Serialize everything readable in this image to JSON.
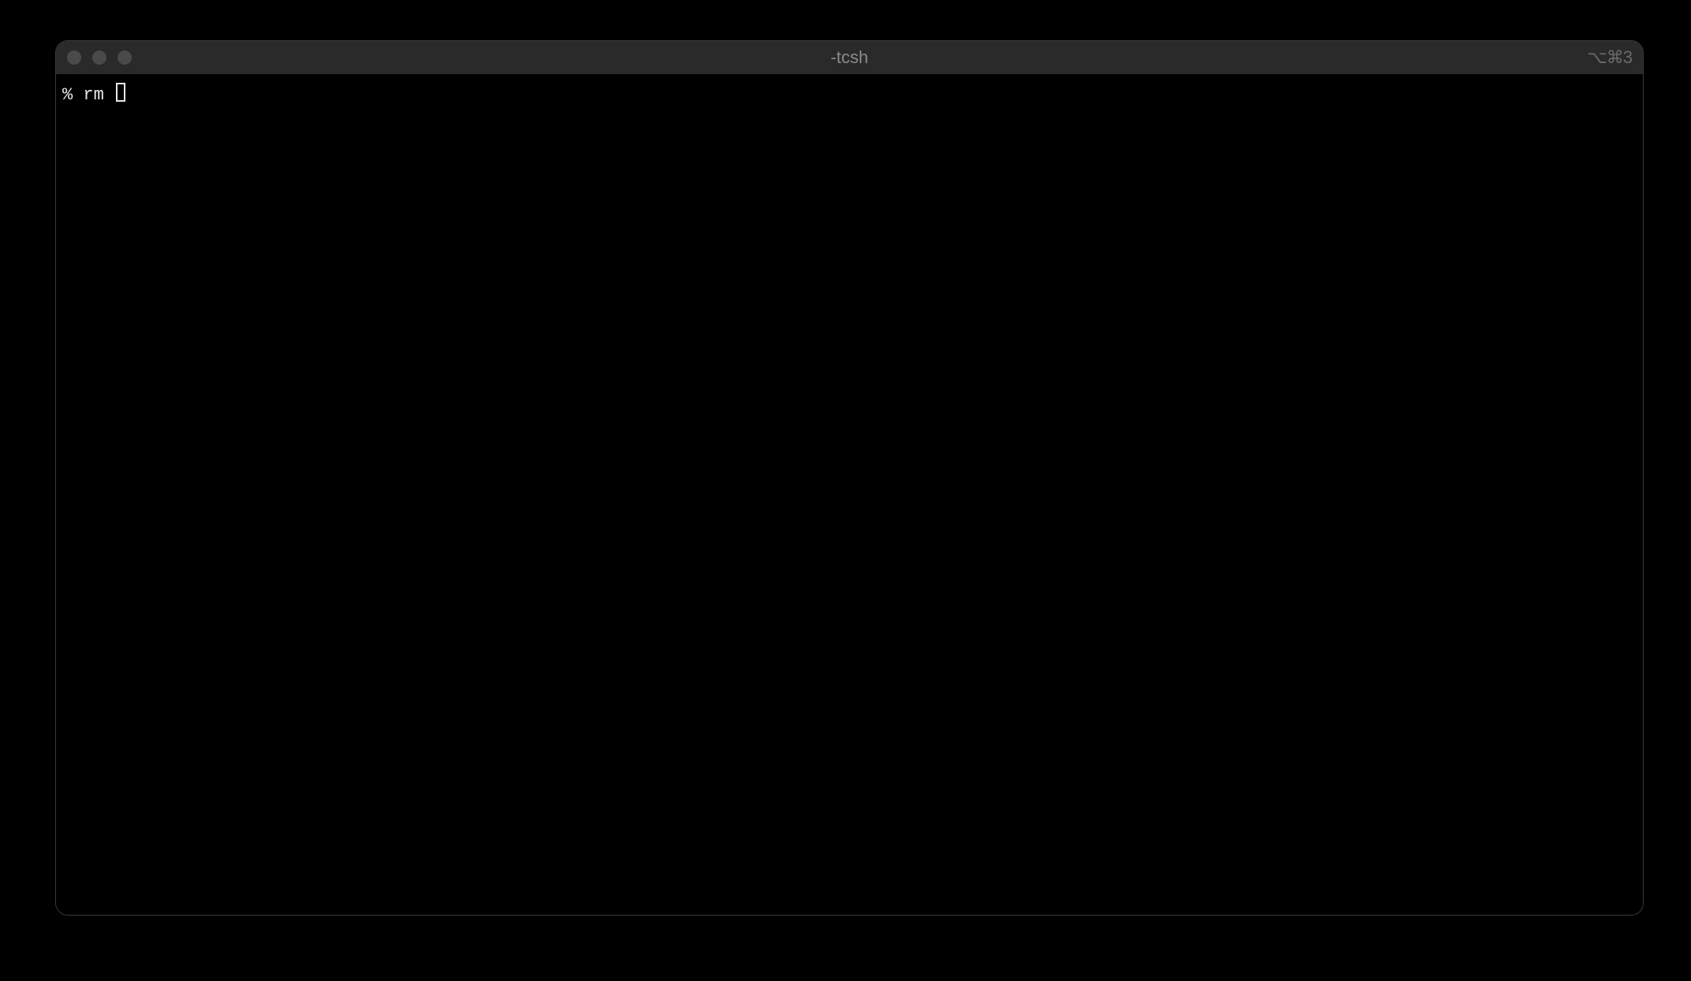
{
  "window": {
    "title": "-tcsh",
    "shortcut": "⌥⌘3"
  },
  "terminal": {
    "prompt": "% ",
    "command": "rm "
  }
}
